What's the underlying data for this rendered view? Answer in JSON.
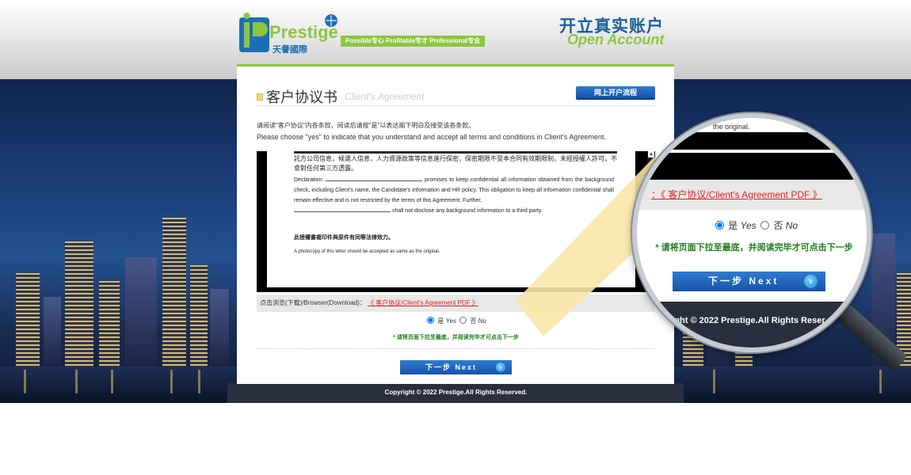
{
  "header": {
    "logo_text": "Prestige",
    "logo_sub": "天譽國際",
    "tagline": "Possible专心  Profitable专才  Professional专业",
    "title_cn": "开立真实账户",
    "title_en": "Open Account"
  },
  "card": {
    "title_cn": "客户协议书",
    "title_en": "Client's Agreement",
    "flow_button": "网上开户流程",
    "instruction_cn": "请阅读\"客户协议\"内各条款，阅读后请按\"是\"以表达阁下明白及接受该各条款。",
    "instruction_en": "Please choose \"yes\" to indicate that you understand and accept all terms and conditions in Client's Agreement."
  },
  "document": {
    "cn_line": "託方公司信息，候選人信息，人力資源政策等信息進行保密，保密期限不受本合同有效期限制，未經授權人許可，不會對任何第三方透露。",
    "decl_label": "Declaration:",
    "decl_text_1": "promises to keep confidential all information obtained from the background check, including Client's name, the Candidate's information and HR policy. This obligation to keep all information confidential shall remain effective and is not restricted by the terms of this Agreement. Further,",
    "decl_text_2": "shall not disclose any background information to a third party.",
    "cn_photocopy": "此授權書複印件與原件有同等法律效力。",
    "en_photocopy": "A photocopy of this letter should be accepted as same as the original."
  },
  "download": {
    "label": "点击浏览(下载)/Browser(Download)：",
    "link": "《 客户协议/Client's Agreement PDF 》"
  },
  "choice": {
    "yes_cn": "是",
    "yes_en": "Yes",
    "no_cn": "否",
    "no_en": "No",
    "selected": "yes"
  },
  "notice": "* 请将页面下拉至最底，并阅读完毕才可点击下一步",
  "next_button": "下一步 Next",
  "copyright": "Copyright © 2022 Prestige.All Rights Reserved.",
  "magnifier": {
    "orig_tail": "the original.",
    "dl_link": "：《 客户协议/Client's Agreement PDF 》",
    "copy": "right © 2022 Prestige.All Rights Reser"
  },
  "colors": {
    "brand_blue": "#1c5f99",
    "brand_green": "#8cc63f",
    "button_blue": "#1e63b8",
    "link_red": "#e02020",
    "notice_green": "#1e7d1e"
  }
}
